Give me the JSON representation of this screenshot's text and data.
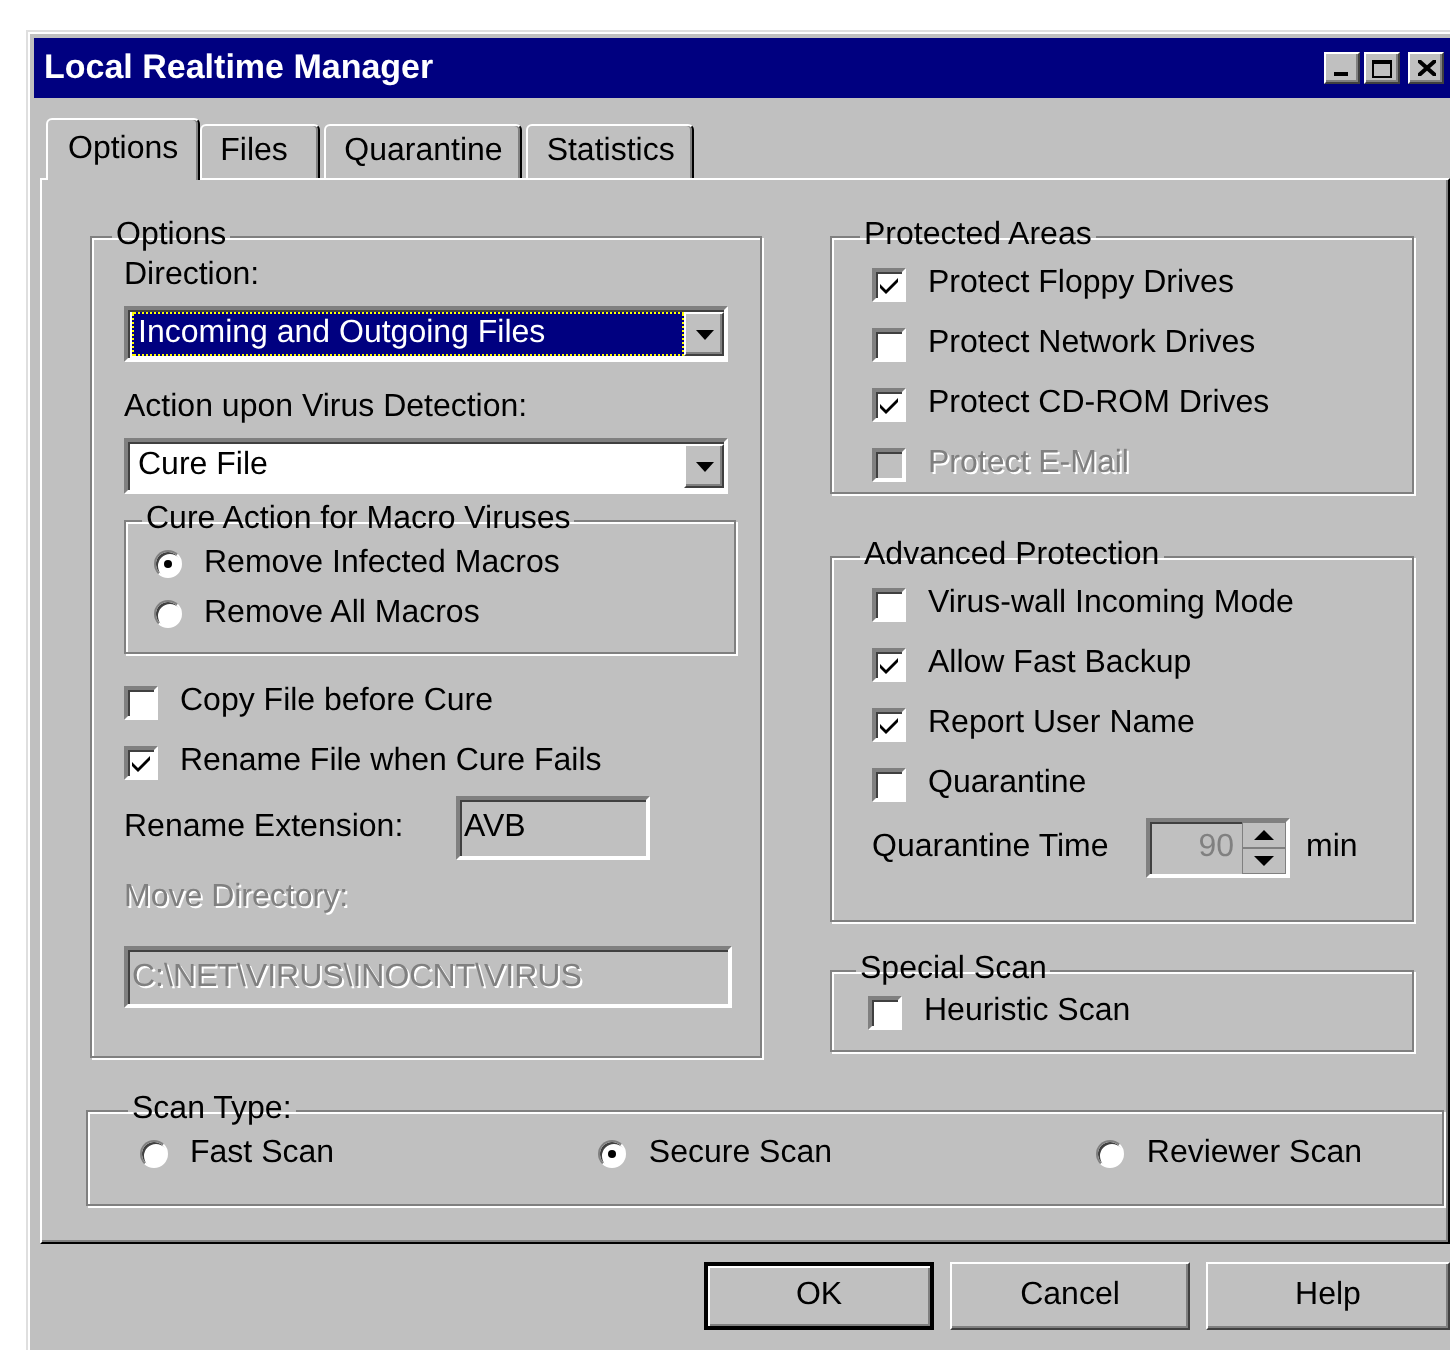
{
  "window": {
    "title": "Local Realtime Manager"
  },
  "tabs": [
    {
      "label": "Options",
      "selected": true
    },
    {
      "label": "Files",
      "selected": false
    },
    {
      "label": "Quarantine",
      "selected": false
    },
    {
      "label": "Statistics",
      "selected": false
    }
  ],
  "options_group": {
    "title": "Options",
    "direction": {
      "label": "Direction:",
      "value": "Incoming and Outgoing Files",
      "focused": true
    },
    "action": {
      "label": "Action upon Virus Detection:",
      "value": "Cure File",
      "focused": false
    },
    "macro_group": {
      "title": "Cure Action for Macro Viruses",
      "options": [
        {
          "label": "Remove Infected Macros",
          "selected": true
        },
        {
          "label": "Remove All Macros",
          "selected": false
        }
      ]
    },
    "checkboxes": [
      {
        "label": "Copy File before Cure",
        "checked": false,
        "disabled": false
      },
      {
        "label": "Rename File when Cure Fails",
        "checked": true,
        "disabled": false
      }
    ],
    "rename_extension": {
      "label": "Rename Extension:",
      "value": "AVB"
    },
    "move_directory": {
      "label": "Move Directory:",
      "value": "C:\\NET\\VIRUS\\INOCNT\\VIRUS",
      "disabled": true
    }
  },
  "protected_areas": {
    "title": "Protected Areas",
    "items": [
      {
        "label": "Protect Floppy Drives",
        "checked": true,
        "disabled": false
      },
      {
        "label": "Protect Network Drives",
        "checked": false,
        "disabled": false
      },
      {
        "label": "Protect CD-ROM Drives",
        "checked": true,
        "disabled": false
      },
      {
        "label": "Protect E-Mail",
        "checked": false,
        "disabled": true
      }
    ]
  },
  "advanced_protection": {
    "title": "Advanced Protection",
    "items": [
      {
        "label": "Virus-wall Incoming Mode",
        "checked": false,
        "disabled": false
      },
      {
        "label": "Allow Fast Backup",
        "checked": true,
        "disabled": false
      },
      {
        "label": "Report User Name",
        "checked": true,
        "disabled": false
      },
      {
        "label": "Quarantine",
        "checked": false,
        "disabled": false
      }
    ],
    "quarantine_time": {
      "label": "Quarantine Time",
      "value": "90",
      "unit": "min",
      "disabled": true
    }
  },
  "special_scan": {
    "title": "Special Scan",
    "items": [
      {
        "label": "Heuristic Scan",
        "checked": false,
        "disabled": false
      }
    ]
  },
  "scan_type": {
    "title": "Scan Type:",
    "options": [
      {
        "label": "Fast Scan",
        "selected": false
      },
      {
        "label": "Secure Scan",
        "selected": true
      },
      {
        "label": "Reviewer Scan",
        "selected": false
      }
    ]
  },
  "buttons": [
    {
      "label": "OK",
      "default": true
    },
    {
      "label": "Cancel",
      "default": false
    },
    {
      "label": "Help",
      "default": false
    }
  ]
}
